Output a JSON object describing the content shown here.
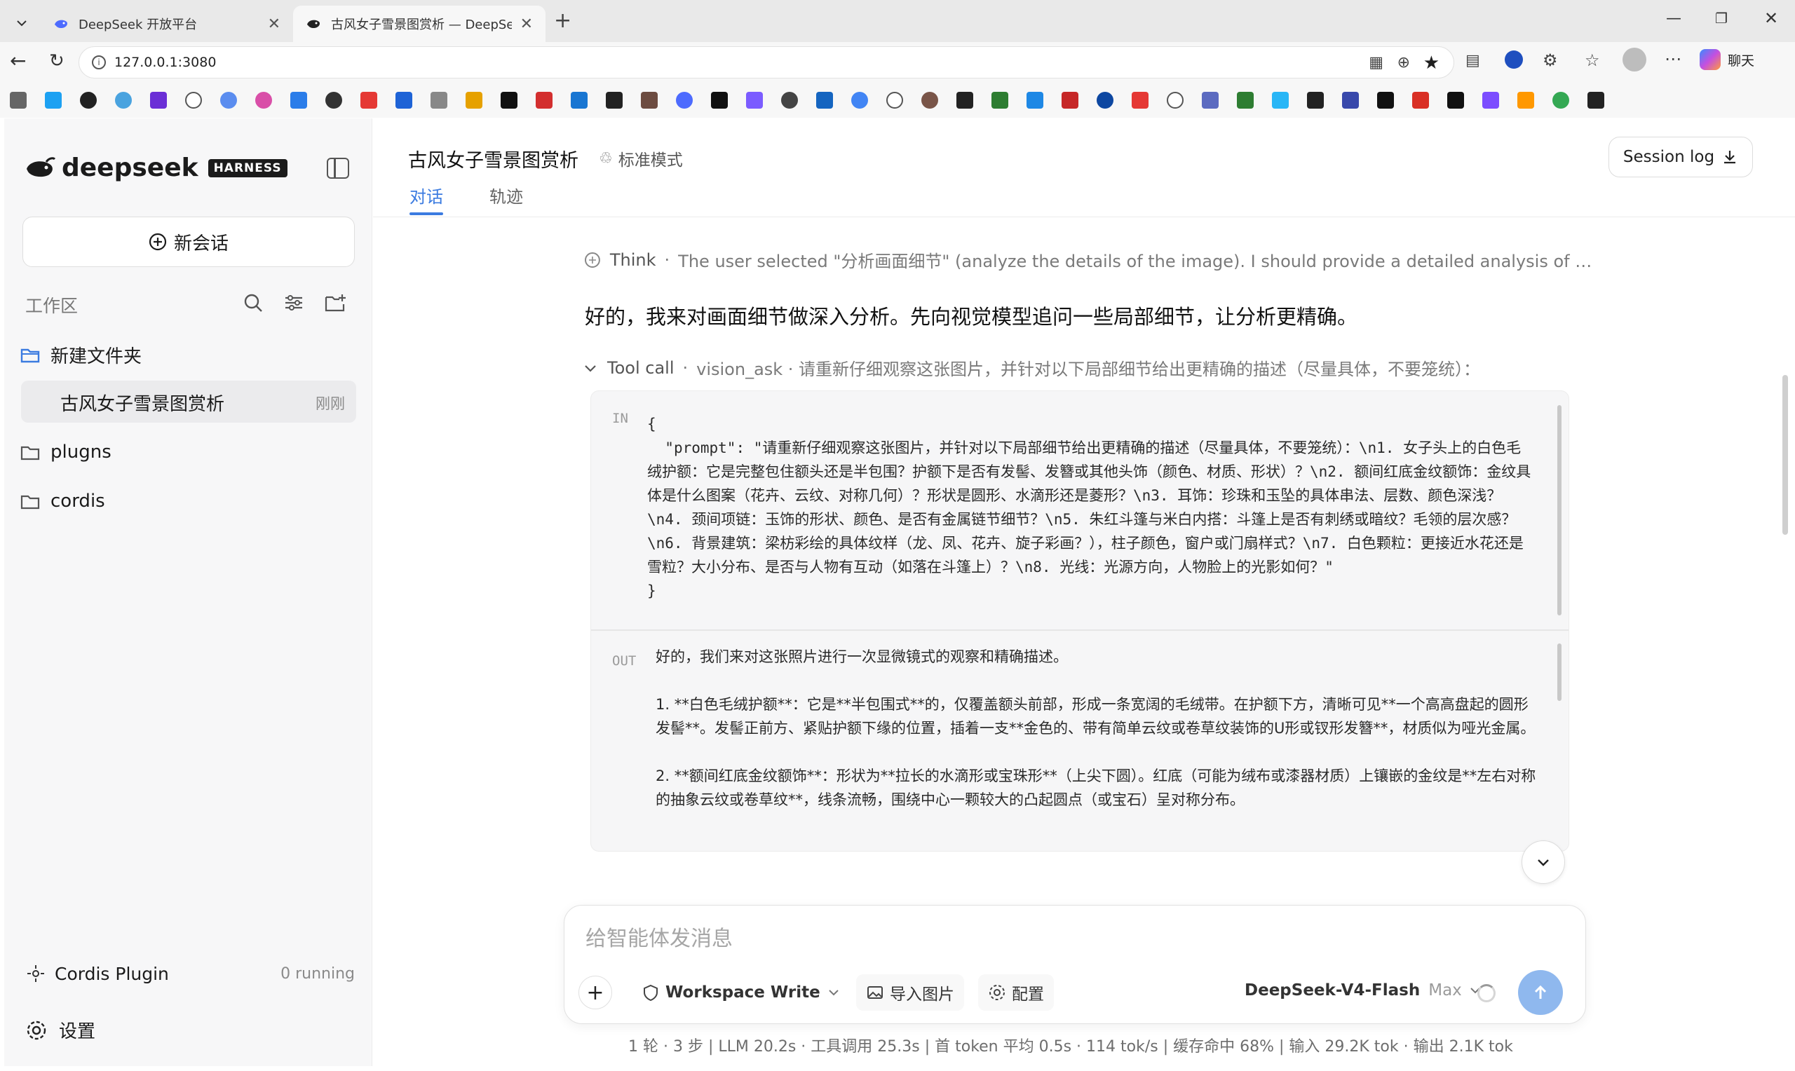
{
  "browser": {
    "tabs": [
      {
        "title": "DeepSeek 开放平台",
        "active": false
      },
      {
        "title": "古风女子雪景图赏析 — DeepSeek",
        "active": true
      }
    ],
    "url": "127.0.0.1:3080",
    "chat_label": "聊天"
  },
  "sidebar": {
    "brand": "deepseek",
    "badge": "HARNESS",
    "new_chat": "新会话",
    "workspace_label": "工作区",
    "tree": [
      {
        "label": "新建文件夹",
        "type": "folder-open"
      },
      {
        "label": "古风女子雪景图赏析",
        "type": "session",
        "time": "刚刚",
        "selected": true
      },
      {
        "label": "plugns",
        "type": "folder"
      },
      {
        "label": "cordis",
        "type": "folder"
      }
    ],
    "plugin": {
      "label": "Cordis Plugin",
      "status": "0 running"
    },
    "settings": "设置"
  },
  "header": {
    "title": "古风女子雪景图赏析",
    "mode": "标准模式",
    "tabs": [
      "对话",
      "轨迹"
    ],
    "session_log": "Session log"
  },
  "conversation": {
    "think_label": "Think",
    "think_text": "The user selected \"分析画面细节\" (analyze the details of the image). I should provide a detailed analysis of t...",
    "answer": "好的，我来对画面细节做深入分析。先向视觉模型追问一些局部细节，让分析更精确。",
    "tool_call_label": "Tool call",
    "tool_call_text": "vision_ask · 请重新仔细观察这张图片，并针对以下局部细节给出更精确的描述（尽量具体，不要笼统）：",
    "in_label": "IN",
    "in_text": "{\n  \"prompt\": \"请重新仔细观察这张图片，并针对以下局部细节给出更精确的描述（尽量具体，不要笼统）：\\n1. 女子头上的白色毛绒护额：它是完整包住额头还是半包围？护额下是否有发髻、发簪或其他头饰（颜色、材质、形状）？\\n2. 额间红底金纹额饰：金纹具体是什么图案（花卉、云纹、对称几何）？形状是圆形、水滴形还是菱形？\\n3. 耳饰：珍珠和玉坠的具体串法、层数、颜色深浅？\\n4. 颈间项链：玉饰的形状、颜色、是否有金属链节细节？\\n5. 朱红斗篷与米白内搭：斗篷上是否有刺绣或暗纹？毛领的层次感？\\n6. 背景建筑：梁枋彩绘的具体纹样（龙、凤、花卉、旋子彩画？），柱子颜色，窗户或门扇样式？\\n7. 白色颗粒：更接近水花还是雪粒？大小分布、是否与人物有互动（如落在斗篷上）？\\n8. 光线：光源方向，人物脸上的光影如何？\"\n}",
    "out_label": "OUT",
    "out_paragraphs": [
      "好的，我们来对这张照片进行一次显微镜式的观察和精确描述。",
      "1.  **白色毛绒护额**：它是**半包围式**的，仅覆盖额头前部，形成一条宽阔的毛绒带。在护额下方，清晰可见**一个高高盘起的圆形发髻**。发髻正前方、紧贴护额下缘的位置，插着一支**金色的、带有简单云纹或卷草纹装饰的U形或钗形发簪**，材质似为哑光金属。",
      "2.  **额间红底金纹额饰**：形状为**拉长的水滴形或宝珠形**（上尖下圆）。红底（可能为绒布或漆器材质）上镶嵌的金纹是**左右对称的抽象云纹或卷草纹**，线条流畅，围绕中心一颗较大的凸起圆点（或宝石）呈对称分布。"
    ]
  },
  "composer": {
    "placeholder": "给智能体发消息",
    "workspace_write": "Workspace Write",
    "import_image": "导入图片",
    "config": "配置",
    "model": "DeepSeek-V4-Flash",
    "model_tier": "Max"
  },
  "stats": "1 轮 · 3 步   |   LLM 20.2s · 工具调用 25.3s   |   首 token 平均 0.5s · 114 tok/s   |   缓存命中 68%   |   输入 29.2K tok · 输出 2.1K tok",
  "colors": {
    "accent": "#3b7be0",
    "send": "#8fb8ee",
    "brand": "#1b1b1b"
  }
}
